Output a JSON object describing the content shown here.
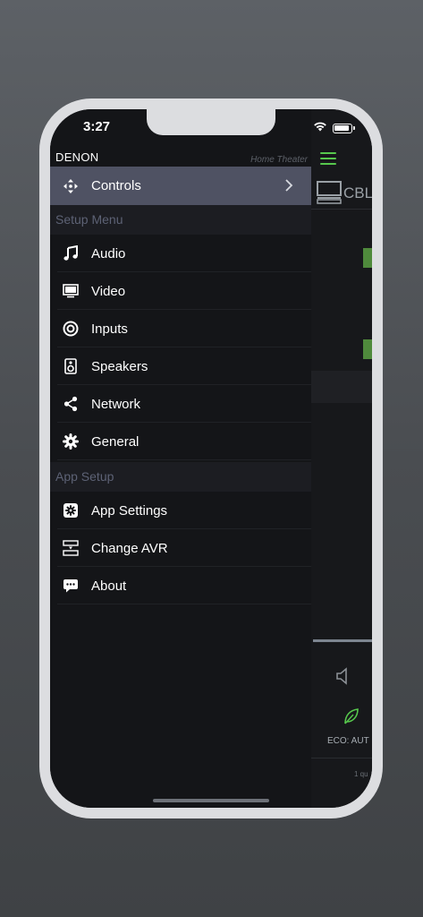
{
  "status": {
    "time": "3:27"
  },
  "drawer": {
    "brand": "DENON",
    "brand_sub": "Home Theater",
    "controls_label": "Controls",
    "setup_menu_title": "Setup Menu",
    "setup_items": [
      {
        "label": "Audio",
        "icon": "music-note-icon"
      },
      {
        "label": "Video",
        "icon": "monitor-icon"
      },
      {
        "label": "Inputs",
        "icon": "input-circle-icon"
      },
      {
        "label": "Speakers",
        "icon": "speaker-icon"
      },
      {
        "label": "Network",
        "icon": "share-network-icon"
      },
      {
        "label": "General",
        "icon": "gear-icon"
      }
    ],
    "app_setup_title": "App Setup",
    "app_items": [
      {
        "label": "App Settings",
        "icon": "app-settings-icon"
      },
      {
        "label": "Change AVR",
        "icon": "change-avr-icon"
      },
      {
        "label": "About",
        "icon": "chat-bubble-icon"
      }
    ]
  },
  "background_app": {
    "source": "CBL",
    "eco": "ECO: AUT",
    "small_text": "1 qu"
  },
  "colors": {
    "accent_green": "#57c84d",
    "selected_row": "#4f5263",
    "section_bg": "#1c1d22"
  }
}
